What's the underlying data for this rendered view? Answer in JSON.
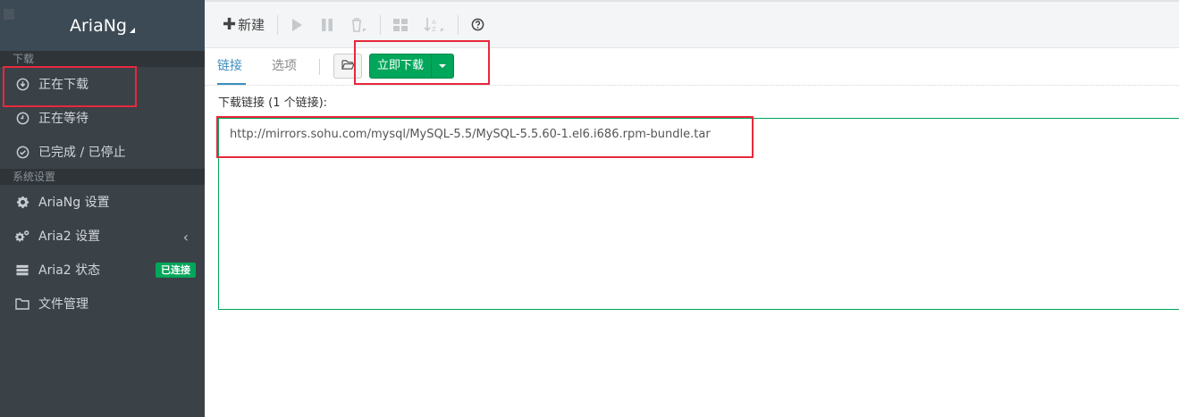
{
  "sidebar": {
    "brand": "AriaNg",
    "sections": [
      {
        "title": "下载"
      },
      {
        "title": "系统设置"
      }
    ],
    "download_items": [
      {
        "label": "正在下载",
        "icon": "download-circle-icon"
      },
      {
        "label": "正在等待",
        "icon": "clock-icon"
      },
      {
        "label": "已完成 / 已停止",
        "icon": "check-circle-icon"
      }
    ],
    "settings_items": [
      {
        "label": "AriaNg 设置",
        "icon": "gear-icon"
      },
      {
        "label": "Aria2 设置",
        "icon": "gears-icon"
      },
      {
        "label": "Aria2 状态",
        "icon": "server-icon",
        "badge": "已连接"
      },
      {
        "label": "文件管理",
        "icon": "folder-icon"
      }
    ]
  },
  "toolbar": {
    "new_label": "新建"
  },
  "tabs": [
    {
      "label": "链接",
      "active": true
    },
    {
      "label": "选项",
      "active": false
    }
  ],
  "actions": {
    "download_now": "立即下载"
  },
  "form": {
    "links_label": "下载链接 (1 个链接):",
    "links_value": "http://mirrors.sohu.com/mysql/MySQL-5.5/MySQL-5.5.60-1.el6.i686.rpm-bundle.tar"
  },
  "colors": {
    "accent": "#3c8dbc",
    "success": "#00a65a",
    "sidebar_bg": "#3a4147",
    "highlight": "#e8283d"
  }
}
